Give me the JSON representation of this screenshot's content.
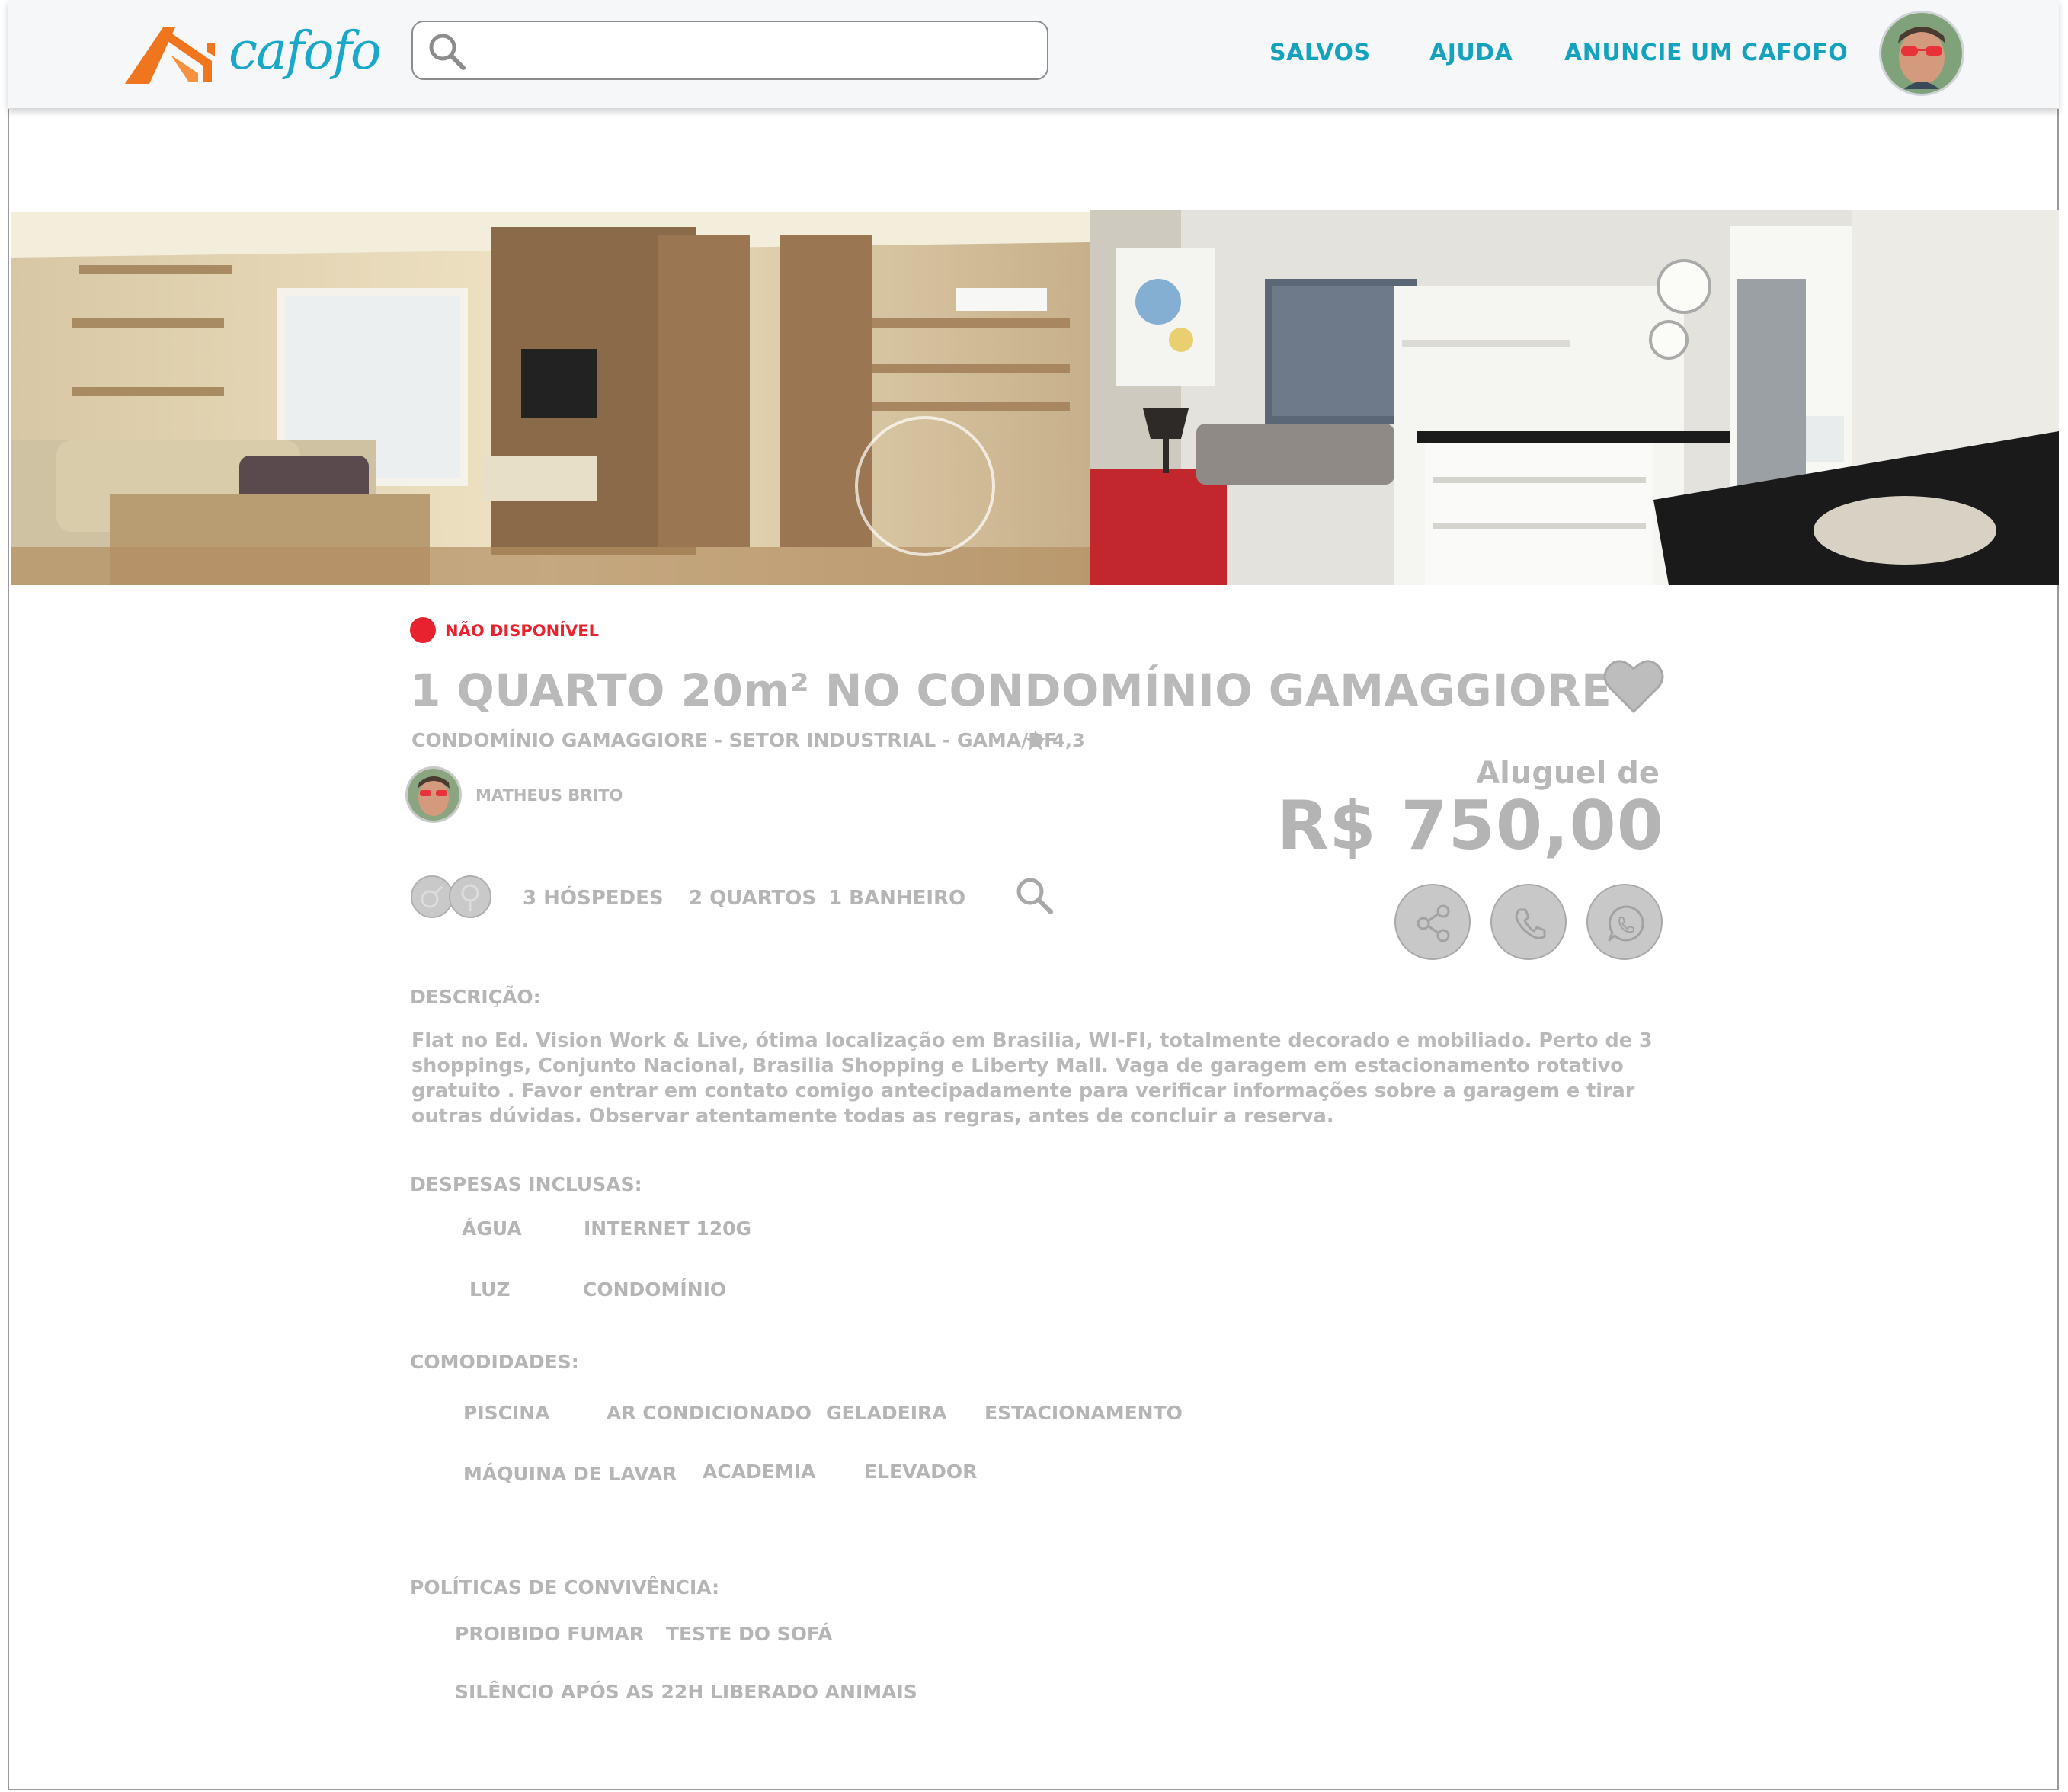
{
  "header": {
    "logo_text": "cafofo",
    "search": {
      "value": "",
      "placeholder": ""
    },
    "nav": {
      "saved": "SALVOS",
      "help": "AJUDA",
      "advertise": "ANUNCIE UM CAFOFO"
    }
  },
  "colors": {
    "brand_orange": "#f0751f",
    "brand_blue": "#15a2be",
    "unavailable_red": "#e8232f",
    "muted_gray": "#b8b8b8"
  },
  "listing": {
    "status": "NÃO DISPONÍVEL",
    "title": "1 QUARTO 20m² NO CONDOMÍNIO GAMAGGIORE",
    "location": "CONDOMÍNIO GAMAGGIORE -  SETOR INDUSTRIAL - GAMA/DF",
    "rating": "4,3",
    "host": "MATHEUS BRITO",
    "price_label": "Aluguel de",
    "price": "R$ 750,00",
    "features": {
      "guests": "3 HÓSPEDES",
      "rooms": "2 QUARTOS",
      "bathrooms": "1 BANHEIRO"
    },
    "description_title": "DESCRIÇÃO:",
    "description": "Flat no Ed. Vision Work & Live, ótima localização em Brasilia, WI-FI, totalmente decorado e mobiliado. Perto de 3 shoppings, Conjunto Nacional, Brasilia Shopping e Liberty Mall. Vaga de garagem em estacionamento rotativo gratuito . Favor entrar em contato comigo antecipadamente para verificar informações sobre a garagem e tirar outras dúvidas. Observar atentamente todas as regras, antes de concluir a reserva.",
    "expenses_title": "DESPESAS INCLUSAS:",
    "expenses": [
      "ÁGUA",
      "INTERNET 120G",
      "LUZ",
      "CONDOMÍNIO"
    ],
    "amenities_title": "COMODIDADES:",
    "amenities": [
      "PISCINA",
      "AR CONDICIONADO",
      "GELADEIRA",
      "ESTACIONAMENTO",
      "MÁQUINA DE LAVAR",
      "ACADEMIA",
      "ELEVADOR"
    ],
    "policies_title": "POLÍTICAS DE CONVIVÊNCIA:",
    "policies": [
      "PROIBIDO FUMAR",
      "TESTE DO SOFÁ",
      "SILÊNCIO APÓS AS 22H",
      "LIBERADO ANIMAIS"
    ]
  },
  "icons": [
    "search-icon",
    "heart-icon",
    "star-icon",
    "gender-icon",
    "zoom-icon",
    "share-icon",
    "phone-icon",
    "whatsapp-icon"
  ]
}
